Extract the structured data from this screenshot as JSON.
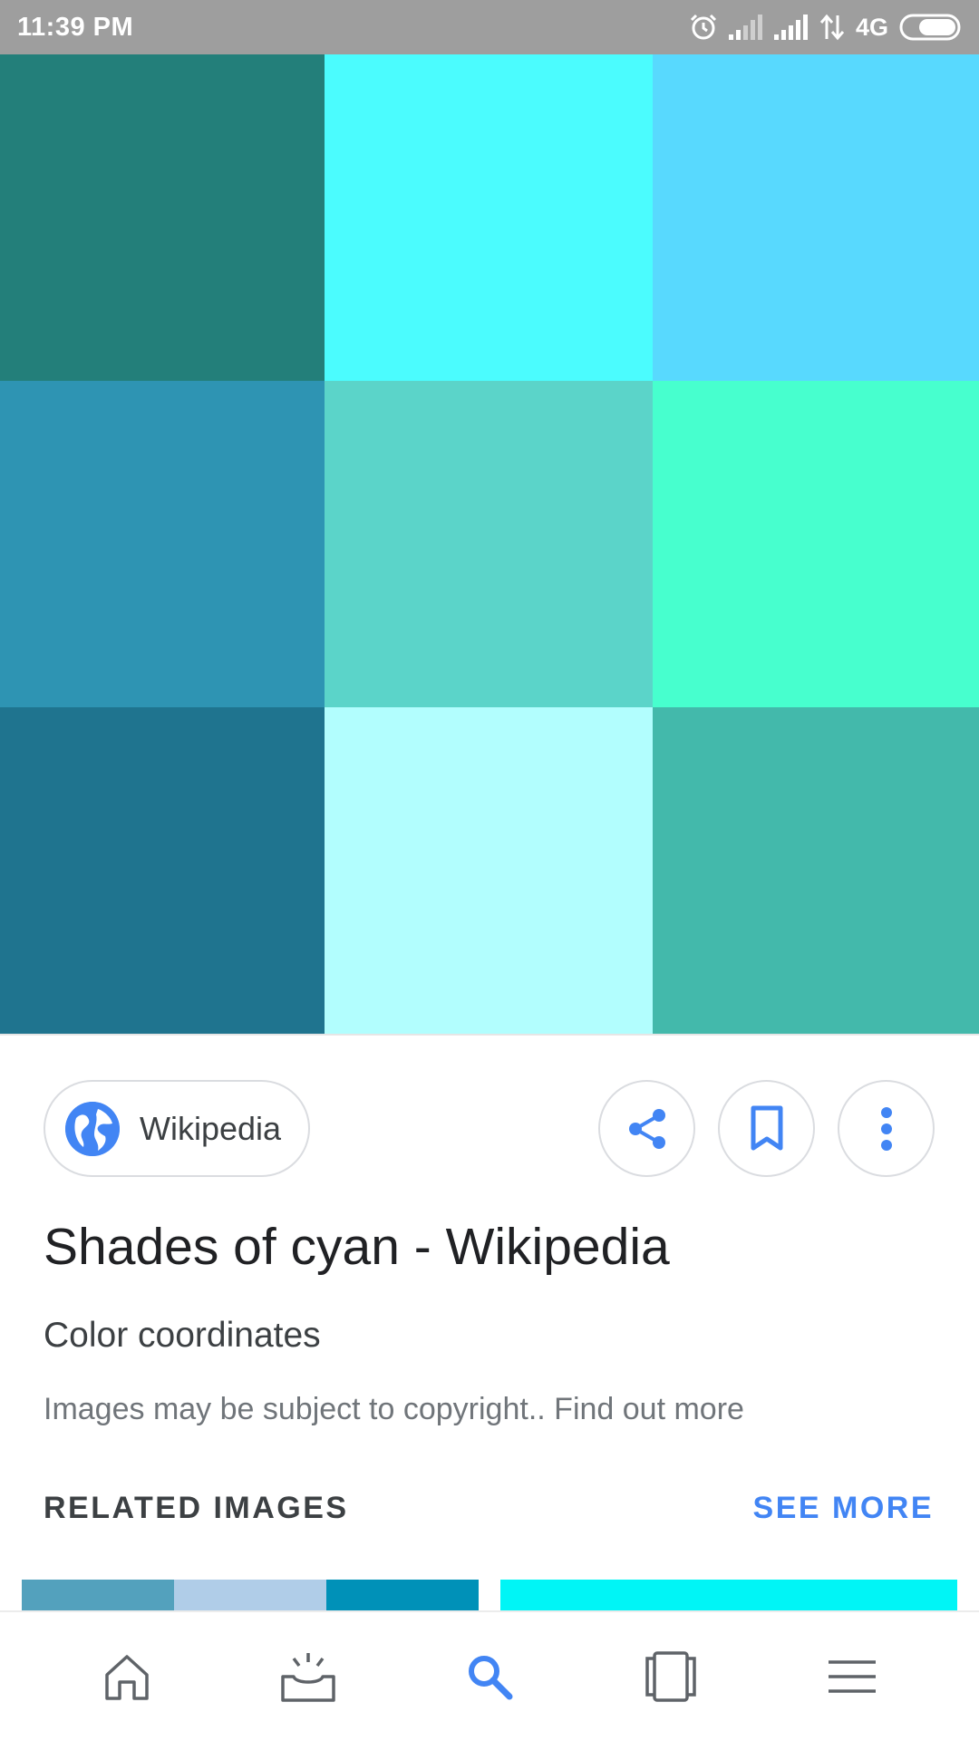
{
  "status_bar": {
    "time": "11:39 PM",
    "network": "4G",
    "icons": [
      "alarm-icon",
      "signal-weak-icon",
      "signal-icon",
      "data-arrows-icon",
      "battery-icon"
    ]
  },
  "image_swatches": [
    {
      "color": "#237f7a"
    },
    {
      "color": "#4bfcfe"
    },
    {
      "color": "#58d9fe"
    },
    {
      "color": "#2e94b3"
    },
    {
      "color": "#5bd4c9"
    },
    {
      "color": "#47ffce"
    },
    {
      "color": "#1f748f"
    },
    {
      "color": "#b2fefe"
    },
    {
      "color": "#43b9ab"
    }
  ],
  "source": {
    "label": "Wikipedia",
    "icon": "globe-icon"
  },
  "actions": {
    "share_icon": "share-icon",
    "save_icon": "bookmark-icon",
    "more_icon": "more-vert-icon"
  },
  "result": {
    "title": "Shades of cyan - Wikipedia",
    "subtitle": "Color coordinates",
    "copyright_text": "Images may be subject to copyright.. ",
    "copyright_link": "Find out more"
  },
  "related": {
    "heading": "RELATED IMAGES",
    "see_more": "SEE MORE",
    "thumb1_colors": [
      "#53a1bd",
      "#b0cde8",
      "#0091b8"
    ],
    "thumb2_color": "#00f5f6"
  },
  "bottom_nav": {
    "items": [
      "home-icon",
      "updates-icon",
      "search-icon",
      "tabs-icon",
      "menu-icon"
    ],
    "active": "search-icon",
    "accent_color": "#4285f4",
    "inactive_color": "#5f6368"
  }
}
